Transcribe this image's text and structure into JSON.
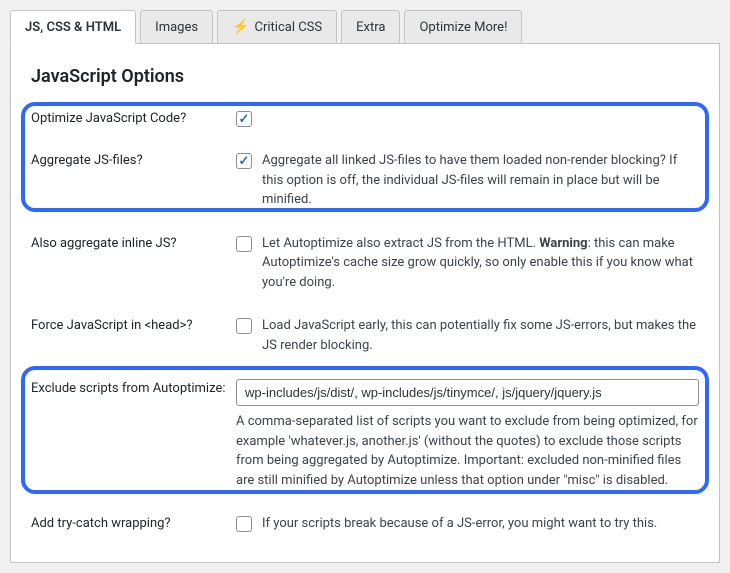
{
  "tabs": {
    "t0": "JS, CSS & HTML",
    "t1": "Images",
    "t2": "Critical CSS",
    "t3": "Extra",
    "t4": "Optimize More!"
  },
  "section_title": "JavaScript Options",
  "rows": {
    "optimize": {
      "label": "Optimize JavaScript Code?"
    },
    "aggregate": {
      "label": "Aggregate JS-files?",
      "desc": "Aggregate all linked JS-files to have them loaded non-render blocking? If this option is off, the individual JS-files will remain in place but will be minified."
    },
    "inline": {
      "label": "Also aggregate inline JS?",
      "desc_a": "Let Autoptimize also extract JS from the HTML. ",
      "desc_warn": "Warning",
      "desc_b": ": this can make Autoptimize's cache size grow quickly, so only enable this if you know what you're doing."
    },
    "forcehead": {
      "label": "Force JavaScript in <head>?",
      "desc": "Load JavaScript early, this can potentially fix some JS-errors, but makes the JS render blocking."
    },
    "exclude": {
      "label": "Exclude scripts from Autoptimize:",
      "value": "wp-includes/js/dist/, wp-includes/js/tinymce/, js/jquery/jquery.js",
      "desc": "A comma-separated list of scripts you want to exclude from being optimized, for example 'whatever.js, another.js' (without the quotes) to exclude those scripts from being aggregated by Autoptimize. Important: excluded non-minified files are still minified by Autoptimize unless that option under \"misc\" is disabled."
    },
    "trycatch": {
      "label": "Add try-catch wrapping?",
      "desc": "If your scripts break because of a JS-error, you might want to try this."
    }
  }
}
